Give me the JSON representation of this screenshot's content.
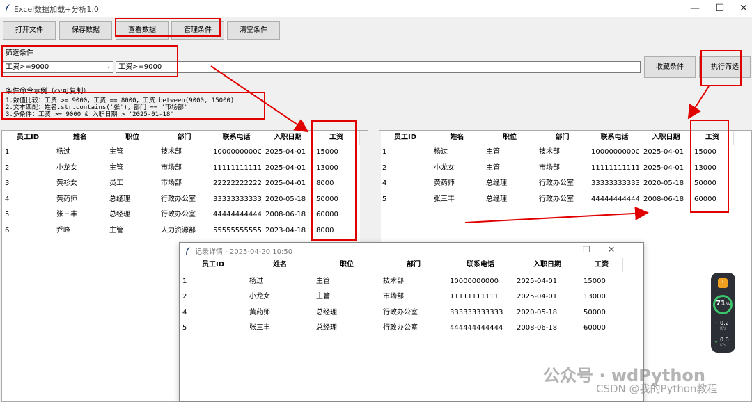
{
  "window": {
    "title": "Excel数据加载+分析1.0",
    "controls": [
      "—",
      "☐",
      "✕"
    ]
  },
  "toolbar": [
    "打开文件",
    "保存数据",
    "查看数据",
    "管理条件",
    "清空条件"
  ],
  "filter": {
    "section_label": "筛选条件",
    "combo_value": "工资>=9000",
    "entry_value": "工资>=9000",
    "save_label": "收藏条件",
    "run_label": "执行筛选"
  },
  "examples": {
    "label": "条件命令示例（cv可复制）",
    "lines": [
      "1.数值比较：工资 >= 9000，工资 == 8000，工资.between(9000, 15000)",
      "2.文本匹配：姓名.str.contains('张')，部门 == '市场部'",
      "3.多条件：工资 >= 9000 & 入职日期 > '2025-01-18'"
    ]
  },
  "columns": [
    "员工ID",
    "姓名",
    "职位",
    "部门",
    "联系电话",
    "入职日期",
    "工资"
  ],
  "left_rows": [
    [
      "1",
      "杨过",
      "主管",
      "技术部",
      "1000000000C",
      "2025-04-01",
      "15000"
    ],
    [
      "2",
      "小龙女",
      "主管",
      "市场部",
      "11111111111",
      "2025-04-01",
      "13000"
    ],
    [
      "3",
      "黄衫女",
      "员工",
      "市场部",
      "22222222222",
      "2025-04-01",
      "8000"
    ],
    [
      "4",
      "黄药师",
      "总经理",
      "行政办公室",
      "33333333333",
      "2020-05-18",
      "50000"
    ],
    [
      "5",
      "张三丰",
      "总经理",
      "行政办公室",
      "44444444444",
      "2008-06-18",
      "60000"
    ],
    [
      "6",
      "乔峰",
      "主管",
      "人力资源部",
      "55555555555",
      "2023-04-18",
      "8000"
    ]
  ],
  "right_rows": [
    [
      "1",
      "杨过",
      "主管",
      "技术部",
      "1000000000C",
      "2025-04-01",
      "15000"
    ],
    [
      "2",
      "小龙女",
      "主管",
      "市场部",
      "11111111111",
      "2025-04-01",
      "13000"
    ],
    [
      "4",
      "黄药师",
      "总经理",
      "行政办公室",
      "33333333333",
      "2020-05-18",
      "50000"
    ],
    [
      "5",
      "张三丰",
      "总经理",
      "行政办公室",
      "44444444444",
      "2008-06-18",
      "60000"
    ]
  ],
  "popup": {
    "title": "记录详情 - 2025-04-20 10:50",
    "rows": [
      [
        "1",
        "杨过",
        "主管",
        "技术部",
        "10000000000",
        "2025-04-01",
        "15000"
      ],
      [
        "2",
        "小龙女",
        "主管",
        "市场部",
        "11111111111",
        "2025-04-01",
        "13000"
      ],
      [
        "4",
        "黄药师",
        "总经理",
        "行政办公室",
        "333333333333",
        "2020-05-18",
        "50000"
      ],
      [
        "5",
        "张三丰",
        "总经理",
        "行政办公室",
        "444444444444",
        "2008-06-18",
        "60000"
      ]
    ]
  },
  "widget": {
    "percent": "71",
    "unit": "%",
    "up": "0.2",
    "down": "0.0",
    "rate_unit": "K/s"
  },
  "watermark": {
    "text": "公众号 · wdPython",
    "csdn": "CSDN @我的Python教程"
  },
  "colors": {
    "annotation_red": "#e00000"
  }
}
